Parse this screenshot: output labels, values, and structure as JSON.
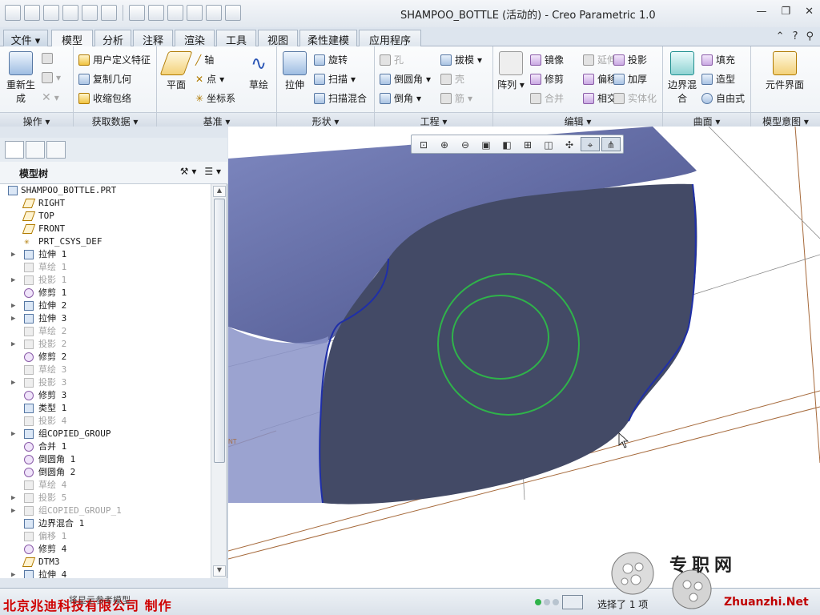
{
  "window": {
    "title": "SHAMPOO_BOTTLE (活动的) - Creo Parametric 1.0"
  },
  "tabs": [
    "文件",
    "模型",
    "分析",
    "注释",
    "渲染",
    "工具",
    "视图",
    "柔性建模",
    "应用程序"
  ],
  "ribbon": {
    "operations": {
      "label": "操作",
      "regenerate": "重新生成"
    },
    "get_data": {
      "label": "获取数据",
      "items": [
        "用户定义特征",
        "复制几何",
        "收缩包络"
      ]
    },
    "datum": {
      "label": "基准",
      "plane": "平面",
      "axis": "轴",
      "point": "点",
      "csys": "坐标系",
      "sketch": "草绘"
    },
    "shapes": {
      "label": "形状",
      "extrude": "拉伸",
      "revolve": "旋转",
      "sweep": "扫描",
      "swept_blend": "扫描混合"
    },
    "engineering": {
      "label": "工程",
      "hole": "孔",
      "round": "倒圆角",
      "chamfer": "倒角",
      "draft": "拔模",
      "shell": "壳",
      "rib": "筋"
    },
    "editing": {
      "label": "编辑",
      "pattern": "阵列",
      "mirror": "镜像",
      "trim": "修剪",
      "merge": "合并",
      "extend": "延伸",
      "offset": "偏移",
      "intersect": "相交",
      "project": "投影",
      "thicken": "加厚",
      "solidify": "实体化"
    },
    "surfaces": {
      "label": "曲面",
      "boundary_blend": "边界混合",
      "fill": "填充",
      "style": "造型",
      "freestyle": "自由式"
    },
    "model_intent": {
      "label": "模型意图",
      "component_interface": "元件界面"
    }
  },
  "model_tree": {
    "title": "模型树",
    "items": [
      {
        "label": "SHAMPOO_BOTTLE.PRT",
        "icon": "part-icon",
        "dim": false,
        "expandable": false,
        "indent": 0
      },
      {
        "label": "RIGHT",
        "icon": "datum-plane-icon",
        "dim": false,
        "expandable": false,
        "indent": 1
      },
      {
        "label": "TOP",
        "icon": "datum-plane-icon",
        "dim": false,
        "expandable": false,
        "indent": 1
      },
      {
        "label": "FRONT",
        "icon": "datum-plane-icon",
        "dim": false,
        "expandable": false,
        "indent": 1
      },
      {
        "label": "PRT_CSYS_DEF",
        "icon": "csys-icon",
        "dim": false,
        "expandable": false,
        "indent": 1
      },
      {
        "label": "拉伸 1",
        "icon": "extrude-icon",
        "dim": false,
        "expandable": true,
        "indent": 1
      },
      {
        "label": "草绘 1",
        "icon": "sketch-icon",
        "dim": true,
        "expandable": false,
        "indent": 1
      },
      {
        "label": "投影 1",
        "icon": "project-icon",
        "dim": true,
        "expandable": true,
        "indent": 1
      },
      {
        "label": "修剪 1",
        "icon": "trim-icon",
        "dim": false,
        "expandable": false,
        "indent": 1
      },
      {
        "label": "拉伸 2",
        "icon": "extrude-icon",
        "dim": false,
        "expandable": true,
        "indent": 1
      },
      {
        "label": "拉伸 3",
        "icon": "extrude-icon",
        "dim": false,
        "expandable": true,
        "indent": 1
      },
      {
        "label": "草绘 2",
        "icon": "sketch-icon",
        "dim": true,
        "expandable": false,
        "indent": 1
      },
      {
        "label": "投影 2",
        "icon": "project-icon",
        "dim": true,
        "expandable": true,
        "indent": 1
      },
      {
        "label": "修剪 2",
        "icon": "trim-icon",
        "dim": false,
        "expandable": false,
        "indent": 1
      },
      {
        "label": "草绘 3",
        "icon": "sketch-icon",
        "dim": true,
        "expandable": false,
        "indent": 1
      },
      {
        "label": "投影 3",
        "icon": "project-icon",
        "dim": true,
        "expandable": true,
        "indent": 1
      },
      {
        "label": "修剪 3",
        "icon": "trim-icon",
        "dim": false,
        "expandable": false,
        "indent": 1
      },
      {
        "label": "类型 1",
        "icon": "style-icon",
        "dim": false,
        "expandable": false,
        "indent": 1
      },
      {
        "label": "投影 4",
        "icon": "project-icon",
        "dim": true,
        "expandable": false,
        "indent": 1
      },
      {
        "label": "组COPIED_GROUP",
        "icon": "group-icon",
        "dim": false,
        "expandable": true,
        "indent": 1
      },
      {
        "label": "合并 1",
        "icon": "merge-icon",
        "dim": false,
        "expandable": false,
        "indent": 1
      },
      {
        "label": "倒圆角 1",
        "icon": "round-icon",
        "dim": false,
        "expandable": false,
        "indent": 1
      },
      {
        "label": "倒圆角 2",
        "icon": "round-icon",
        "dim": false,
        "expandable": false,
        "indent": 1
      },
      {
        "label": "草绘 4",
        "icon": "sketch-icon",
        "dim": true,
        "expandable": false,
        "indent": 1
      },
      {
        "label": "投影 5",
        "icon": "project-icon",
        "dim": true,
        "expandable": true,
        "indent": 1
      },
      {
        "label": "组COPIED_GROUP_1",
        "icon": "group-icon",
        "dim": true,
        "expandable": true,
        "indent": 1
      },
      {
        "label": "边界混合 1",
        "icon": "boundary-blend-icon",
        "dim": false,
        "expandable": false,
        "indent": 1
      },
      {
        "label": "偏移 1",
        "icon": "offset-icon",
        "dim": true,
        "expandable": false,
        "indent": 1
      },
      {
        "label": "修剪 4",
        "icon": "trim-icon",
        "dim": false,
        "expandable": false,
        "indent": 1
      },
      {
        "label": "DTM3",
        "icon": "datum-plane-icon",
        "dim": false,
        "expandable": false,
        "indent": 1
      },
      {
        "label": "拉伸 4",
        "icon": "extrude-icon",
        "dim": false,
        "expandable": true,
        "indent": 1
      }
    ]
  },
  "status": {
    "company": "北京兆迪科技有限公司  制作",
    "message": "将显示参考模型",
    "selection": "选择了 1 项"
  },
  "watermark": {
    "cn": "专职网",
    "url": "Zhuanzhi.Net"
  },
  "colors": {
    "model_face": "#434a66",
    "model_side": "#6a73a8",
    "edge_blue": "#1f2fa8",
    "circle_green": "#2fb34a",
    "datum_brown": "#a66a3c"
  }
}
